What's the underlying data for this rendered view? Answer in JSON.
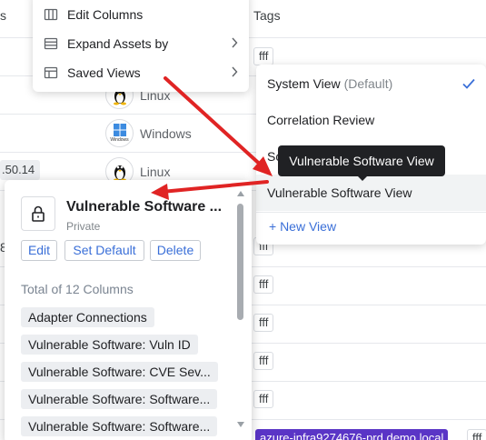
{
  "table": {
    "col_partial_header": "s",
    "tags_header": "Tags",
    "tag_value": "fff",
    "ip_partial": ".50.14",
    "os_rows": [
      {
        "icon": "linux-tux-icon",
        "label": "Linux"
      },
      {
        "icon": "windows-logo-icon",
        "label": "Windows"
      },
      {
        "icon": "linux-tux-icon",
        "label": "Linux"
      }
    ],
    "windows_logo_caption": "Windows",
    "partial_row_label": "8",
    "hostname_chip": "azure-infra9274676-prd.demo.local",
    "hostname_tag_partial": "fff"
  },
  "context_menu": {
    "items": [
      {
        "icon": "edit-columns-icon",
        "label": "Edit Columns",
        "has_submenu": false
      },
      {
        "icon": "expand-assets-icon",
        "label": "Expand Assets by",
        "has_submenu": true
      },
      {
        "icon": "saved-views-icon",
        "label": "Saved Views",
        "has_submenu": true
      }
    ]
  },
  "saved_views": {
    "items": [
      {
        "label": "System View",
        "suffix": "(Default)",
        "checked": true
      },
      {
        "label": "Correlation Review",
        "suffix": "",
        "checked": false
      },
      {
        "label": "So",
        "suffix": "",
        "checked": false
      },
      {
        "label": "Vulnerable Software View",
        "suffix": "",
        "checked": false
      }
    ],
    "new_view_label": "+ New View",
    "tooltip": "Vulnerable Software View",
    "check_color": "#3a6fd8"
  },
  "view_details": {
    "name": "Vulnerable Software ...",
    "privacy": "Private",
    "edit_label": "Edit",
    "set_default_label": "Set Default",
    "delete_label": "Delete",
    "total_label": "Total of 12 Columns",
    "columns": [
      "Adapter Connections",
      "Vulnerable Software: Vuln ID",
      "Vulnerable Software: CVE Sev...",
      "Vulnerable Software: Software...",
      "Vulnerable Software: Software..."
    ]
  },
  "colors": {
    "accent": "#3a6fd8",
    "annotation_arrow": "#e02424",
    "hostname_chip_bg": "#5a35c6"
  }
}
